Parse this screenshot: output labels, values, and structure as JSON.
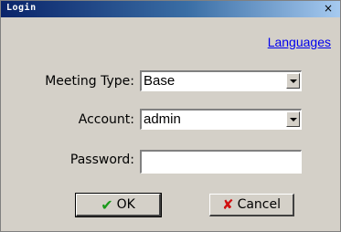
{
  "window": {
    "title": "Login",
    "close_glyph": "×"
  },
  "languages_link": "Languages",
  "form": {
    "meeting_type": {
      "label": "Meeting Type:",
      "value": "Base"
    },
    "account": {
      "label": "Account:",
      "value": "admin"
    },
    "password": {
      "label": "Password:",
      "value": ""
    }
  },
  "buttons": {
    "ok": {
      "label": "OK",
      "icon": "checkmark-icon",
      "icon_glyph": "✔",
      "icon_color": "#1a9a1a"
    },
    "cancel": {
      "label": "Cancel",
      "icon": "x-icon",
      "icon_glyph": "✘",
      "icon_color": "#d01010"
    }
  }
}
